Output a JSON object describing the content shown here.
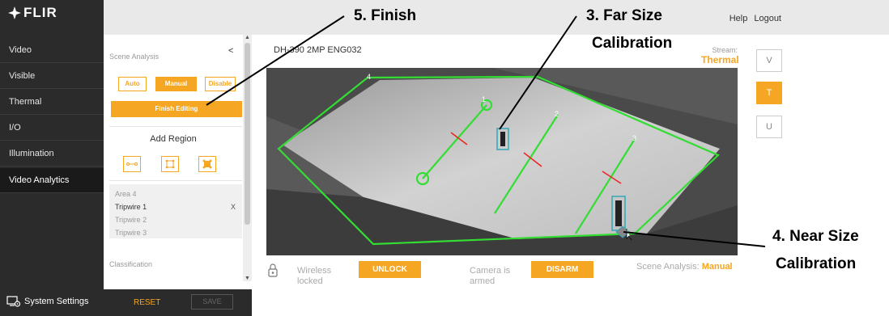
{
  "app": {
    "logo": "FLIR",
    "logo_icon": "flir-star-icon",
    "help": "Help",
    "logout": "Logout"
  },
  "sidebar": {
    "items": [
      {
        "label": "Video"
      },
      {
        "label": "Visible"
      },
      {
        "label": "Thermal"
      },
      {
        "label": "I/O"
      },
      {
        "label": "Illumination"
      },
      {
        "label": "Video Analytics"
      }
    ],
    "system_settings": "System Settings"
  },
  "panel": {
    "title": "Scene Analysis",
    "collapse": "<",
    "modes": [
      "Auto",
      "Manual",
      "Disable"
    ],
    "selected_mode": "Manual",
    "finish": "Finish Editing",
    "add_region": "Add Region",
    "regions": [
      "Area 4",
      "Tripwire 1",
      "Tripwire 2",
      "Tripwire 3"
    ],
    "selected_region": "Tripwire 1",
    "remove": "X",
    "classification": "Classification",
    "reset": "RESET",
    "save": "SAVE"
  },
  "camera": {
    "name": "DH-390 2MP ENG032",
    "stream_label": "Stream:",
    "stream_value": "Thermal",
    "stream_buttons": [
      "V",
      "T",
      "U"
    ],
    "selected_stream": "T",
    "region_labels": [
      "4",
      "1",
      "2",
      "3"
    ]
  },
  "status": {
    "wireless_line1": "Wireless",
    "wireless_line2": "locked",
    "unlock": "UNLOCK",
    "camera_line1": "Camera is",
    "camera_line2": "armed",
    "disarm": "DISARM",
    "scene_label": "Scene Analysis:",
    "scene_value": "Manual"
  },
  "callouts": {
    "finish": "5. Finish",
    "far_line1": "3. Far Size",
    "far_line2": "Calibration",
    "near_line1": "4. Near Size",
    "near_line2": "Calibration"
  },
  "colors": {
    "accent": "#f5a623",
    "zone": "#33dd33",
    "sidebar": "#2b2b2b",
    "direction_arrow": "#ee2222"
  }
}
